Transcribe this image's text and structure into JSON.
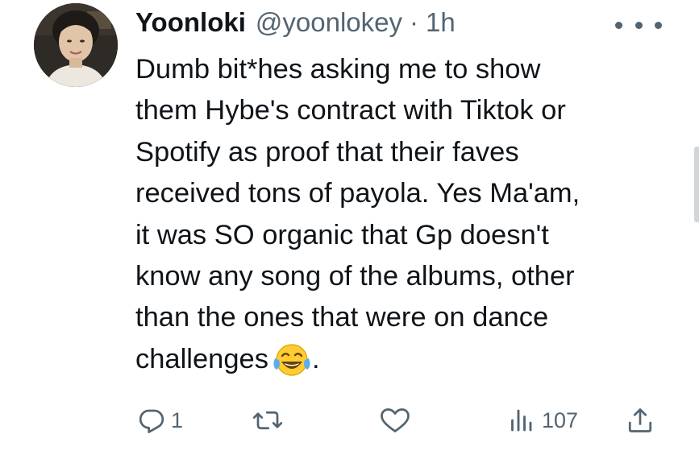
{
  "tweet": {
    "display_name": "Yoonloki",
    "handle": "@yoonlokey",
    "separator": "·",
    "time": "1h",
    "lines": [
      "Dumb bit*hes asking me to show",
      "them Hybe's contract with Tiktok or",
      "Spotify as proof that their faves",
      "received tons of payola. Yes Ma'am,",
      "it was SO organic that Gp doesn't",
      "know any song of the albums, other",
      "than the ones that were on dance",
      "challenges"
    ],
    "emoji": "face-with-tears-of-joy",
    "trailing_text": "."
  },
  "actions": {
    "reply_count": "1",
    "retweet_count": "",
    "like_count": "",
    "view_count": "107"
  },
  "icons": {
    "more": "more-horizontal-icon",
    "reply": "reply-icon",
    "retweet": "retweet-icon",
    "like": "heart-icon",
    "views": "views-icon",
    "share": "share-icon"
  },
  "colors": {
    "text": "#0f1419",
    "secondary": "#536471",
    "background": "#ffffff"
  }
}
